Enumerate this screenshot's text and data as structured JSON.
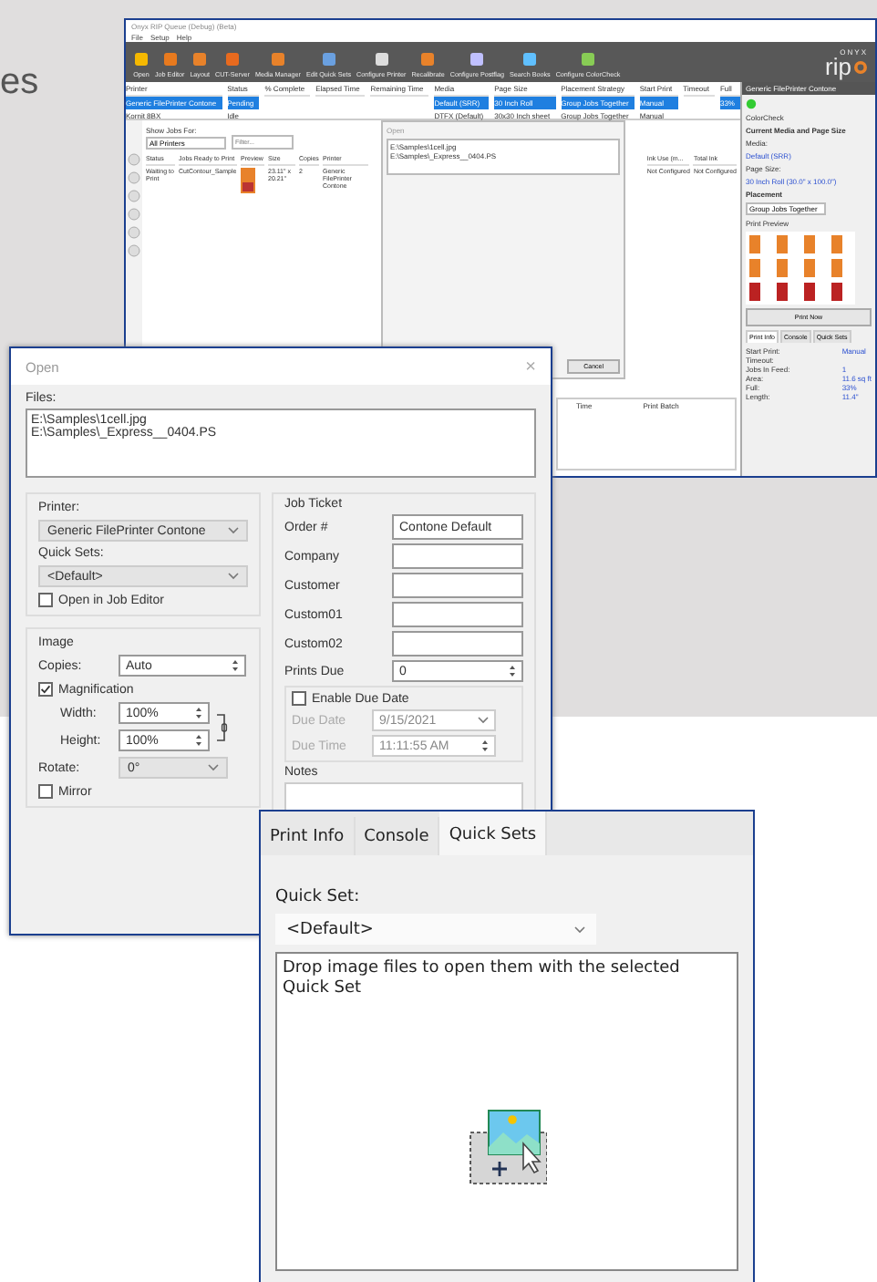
{
  "page_fragment": "es",
  "main_window": {
    "title": "Onyx RIP Queue (Debug) (Beta)",
    "menu": [
      "File",
      "Setup",
      "Help"
    ],
    "toolbar": [
      "Open",
      "Job Editor",
      "Layout",
      "CUT-Server",
      "Media Manager",
      "Edit Quick Sets",
      "Configure Printer",
      "Recalibrate",
      "Configure Postflag",
      "Search Books",
      "Configure ColorCheck"
    ],
    "logo_top": "ONYX",
    "logo": "rip",
    "printers": {
      "columns": [
        "Printer",
        "Status",
        "% Complete",
        "Elapsed Time",
        "Remaining Time",
        "Media",
        "Page Size",
        "Placement Strategy",
        "Start Print",
        "Timeout",
        "Full"
      ],
      "rows": [
        {
          "selected": true,
          "cells": [
            "Generic FilePrinter Contone",
            "Pending",
            "",
            "",
            "",
            "Default (SRR)",
            "30 Inch Roll",
            "Group Jobs Together",
            "Manual",
            "",
            "33%"
          ]
        },
        {
          "selected": false,
          "cells": [
            "Kornit 8BX",
            "Idle",
            "",
            "",
            "",
            "DTFX (Default)",
            "30x30 Inch sheet",
            "Group Jobs Together",
            "Manual",
            "",
            ""
          ]
        }
      ]
    },
    "show_jobs_label": "Show Jobs For:",
    "show_jobs_value": "All Printers",
    "filter_placeholder": "Filter...",
    "jobs": {
      "columns": [
        "Status",
        "Jobs Ready to Print",
        "Preview",
        "Size",
        "Copies",
        "Printer"
      ],
      "rows": [
        {
          "selected": false,
          "cells": [
            "Waiting to Print",
            "CutContour_Sample",
            "",
            "23.11\" x 20.21\"",
            "2",
            "Generic FilePrinter Contone"
          ]
        }
      ]
    },
    "jobs_extra_columns": [
      "Ink Use (m...",
      "Total Ink"
    ],
    "jobs_extra_cells": [
      "Not Configured",
      "Not Configured"
    ],
    "lower_columns": [
      "Time",
      "Print Batch"
    ],
    "mini_dialog": {
      "title": "Open",
      "files": [
        "E:\\Samples\\1cell.jpg",
        "E:\\Samples\\_Express__0404.PS"
      ],
      "cancel": "Cancel"
    },
    "side_panel": {
      "title": "Generic FilePrinter Contone",
      "colorcheck": "ColorCheck",
      "media_heading": "Current Media and Page Size",
      "media_label": "Media:",
      "media_value": "Default (SRR)",
      "page_label": "Page Size:",
      "page_value": "30 Inch Roll (30.0\" x 100.0\")",
      "placement_heading": "Placement",
      "placement_value": "Group Jobs Together",
      "preview_label": "Print Preview",
      "print_now": "Print Now",
      "tabs": [
        {
          "label": "Print Info",
          "selected": true
        },
        {
          "label": "Console",
          "selected": false
        },
        {
          "label": "Quick Sets",
          "selected": false
        }
      ],
      "info": [
        {
          "label": "Start Print:",
          "value": "Manual"
        },
        {
          "label": "Timeout:"
        },
        {
          "label": "Jobs In Feed:",
          "value": "1"
        },
        {
          "label": "Area:",
          "value": "11.6 sq ft"
        },
        {
          "label": "Full:",
          "value": "33%"
        },
        {
          "label": "Length:",
          "value": "11.4\""
        }
      ]
    }
  },
  "open_dialog": {
    "title": "Open",
    "close": "×",
    "files_label": "Files:",
    "files": [
      "E:\\Samples\\1cell.jpg",
      "E:\\Samples\\_Express__0404.PS"
    ],
    "printer_label": "Printer:",
    "printer_value": "Generic FilePrinter Contone",
    "quick_sets_label": "Quick Sets:",
    "quick_sets_value": "<Default>",
    "open_in_editor": {
      "label": "Open in Job Editor",
      "checked": false
    },
    "image_legend": "Image",
    "copies_label": "Copies:",
    "copies_value": "Auto",
    "magnification": {
      "label": "Magnification",
      "checked": true
    },
    "width_label": "Width:",
    "width_value": "100%",
    "height_label": "Height:",
    "height_value": "100%",
    "rotate_label": "Rotate:",
    "rotate_value": "0°",
    "mirror": {
      "label": "Mirror",
      "checked": false
    },
    "job_ticket_legend": "Job Ticket",
    "ticket_fields": [
      {
        "label": "Order #",
        "value": "Contone Default"
      },
      {
        "label": "Company"
      },
      {
        "label": "Customer"
      },
      {
        "label": "Custom01"
      },
      {
        "label": "Custom02"
      }
    ],
    "prints_due_label": "Prints Due",
    "prints_due_value": "0",
    "enable_due_date": {
      "label": "Enable Due Date",
      "checked": false
    },
    "due_date": {
      "label": "Due Date",
      "value": "9/15/2021",
      "disabled": true
    },
    "due_time": {
      "label": "Due Time",
      "value": "11:11:55 AM",
      "disabled": true
    },
    "notes_label": "Notes"
  },
  "quick_sets_panel": {
    "tabs": [
      {
        "label": "Print Info",
        "selected": false
      },
      {
        "label": "Console",
        "selected": false
      },
      {
        "label": "Quick Sets",
        "selected": true
      }
    ],
    "quick_set_label": "Quick Set:",
    "quick_set_value": "<Default>",
    "drop_text": "Drop image files to open them with the selected Quick Set"
  }
}
